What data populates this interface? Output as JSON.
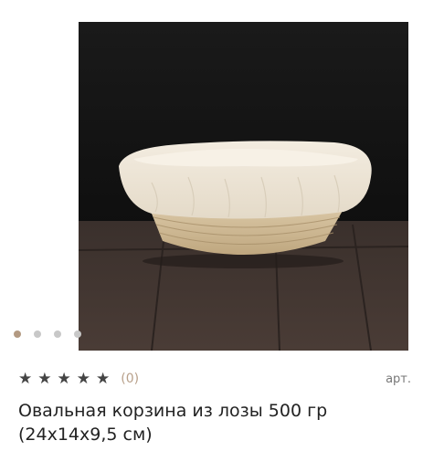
{
  "product": {
    "image_alt": "product-photo",
    "gallery": {
      "count": 4,
      "active_index": 0
    },
    "rating": {
      "stars_filled": 5,
      "max_stars": 5,
      "reviews_text": "(0)"
    },
    "article_label": "арт.",
    "title": "Овальная корзина из лозы 500 гр (24х14х9,5 см)"
  },
  "colors": {
    "active_dot": "#b39a82",
    "inactive_dot": "#c8c8c8",
    "review_count": "#b8a08a"
  }
}
